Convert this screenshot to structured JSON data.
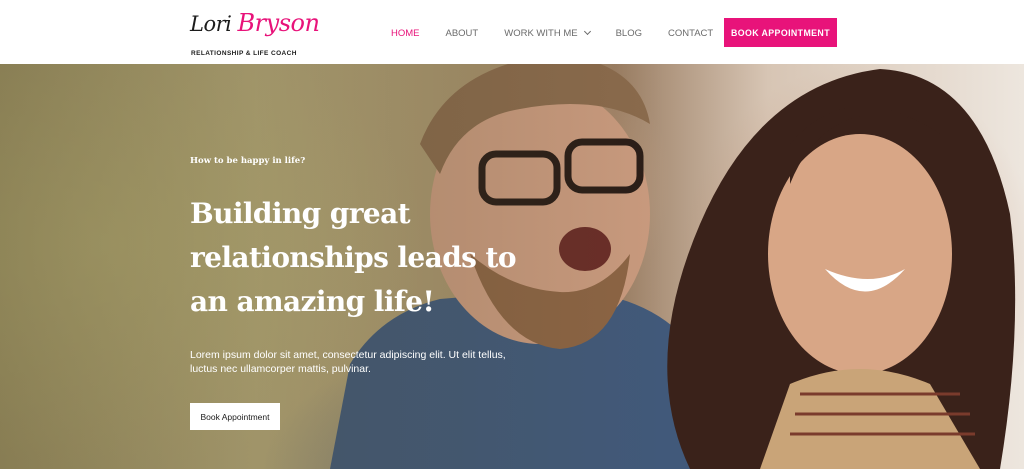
{
  "brand": {
    "first_name": "Lori",
    "last_name": "Bryson",
    "tagline": "RELATIONSHIP & LIFE COACH"
  },
  "nav": {
    "items": [
      {
        "label": "HOME",
        "active": true
      },
      {
        "label": "ABOUT",
        "active": false
      },
      {
        "label": "WORK WITH ME",
        "active": false,
        "has_dropdown": true
      },
      {
        "label": "BLOG",
        "active": false
      },
      {
        "label": "CONTACT",
        "active": false
      }
    ]
  },
  "header_cta": "BOOK APPOINTMENT",
  "hero": {
    "eyebrow": "How to be happy in life?",
    "headline": "Building great relationships leads to an amazing life!",
    "body": "Lorem ipsum dolor sit amet, consectetur adipiscing elit. Ut elit tellus, luctus nec ullamcorper mattis, pulvinar.",
    "button": "Book Appointment"
  },
  "colors": {
    "accent": "#e8137a",
    "text_dark": "#1c1c1c",
    "nav_text": "#6b6b6b"
  }
}
